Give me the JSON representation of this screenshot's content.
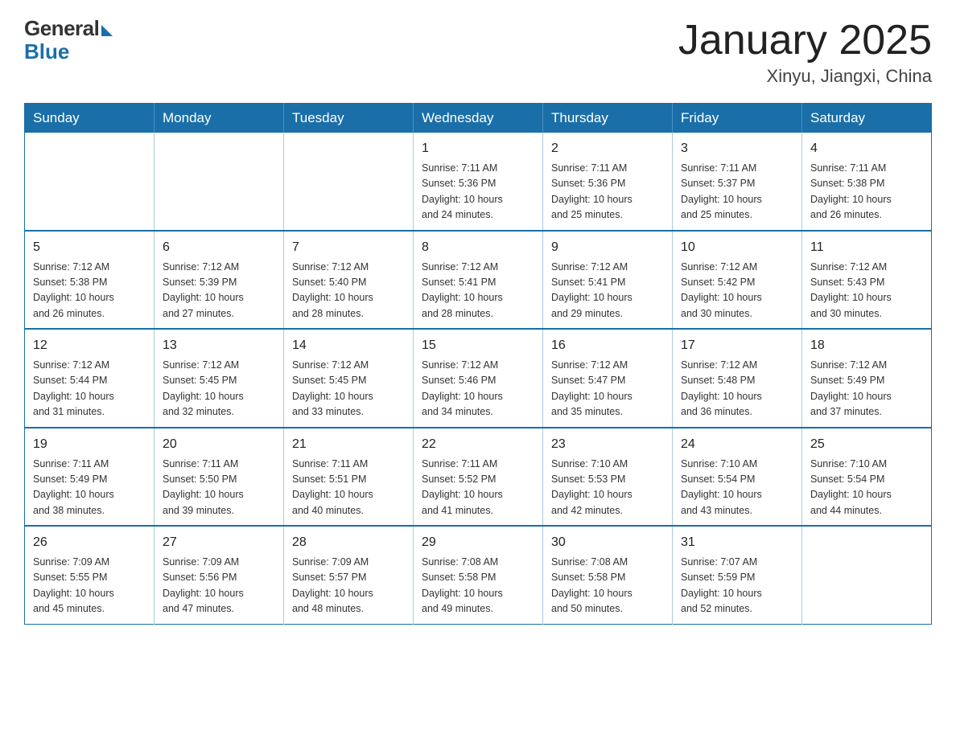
{
  "header": {
    "logo_general": "General",
    "logo_blue": "Blue",
    "title": "January 2025",
    "location": "Xinyu, Jiangxi, China"
  },
  "days_of_week": [
    "Sunday",
    "Monday",
    "Tuesday",
    "Wednesday",
    "Thursday",
    "Friday",
    "Saturday"
  ],
  "weeks": [
    [
      {
        "day": "",
        "info": ""
      },
      {
        "day": "",
        "info": ""
      },
      {
        "day": "",
        "info": ""
      },
      {
        "day": "1",
        "info": "Sunrise: 7:11 AM\nSunset: 5:36 PM\nDaylight: 10 hours\nand 24 minutes."
      },
      {
        "day": "2",
        "info": "Sunrise: 7:11 AM\nSunset: 5:36 PM\nDaylight: 10 hours\nand 25 minutes."
      },
      {
        "day": "3",
        "info": "Sunrise: 7:11 AM\nSunset: 5:37 PM\nDaylight: 10 hours\nand 25 minutes."
      },
      {
        "day": "4",
        "info": "Sunrise: 7:11 AM\nSunset: 5:38 PM\nDaylight: 10 hours\nand 26 minutes."
      }
    ],
    [
      {
        "day": "5",
        "info": "Sunrise: 7:12 AM\nSunset: 5:38 PM\nDaylight: 10 hours\nand 26 minutes."
      },
      {
        "day": "6",
        "info": "Sunrise: 7:12 AM\nSunset: 5:39 PM\nDaylight: 10 hours\nand 27 minutes."
      },
      {
        "day": "7",
        "info": "Sunrise: 7:12 AM\nSunset: 5:40 PM\nDaylight: 10 hours\nand 28 minutes."
      },
      {
        "day": "8",
        "info": "Sunrise: 7:12 AM\nSunset: 5:41 PM\nDaylight: 10 hours\nand 28 minutes."
      },
      {
        "day": "9",
        "info": "Sunrise: 7:12 AM\nSunset: 5:41 PM\nDaylight: 10 hours\nand 29 minutes."
      },
      {
        "day": "10",
        "info": "Sunrise: 7:12 AM\nSunset: 5:42 PM\nDaylight: 10 hours\nand 30 minutes."
      },
      {
        "day": "11",
        "info": "Sunrise: 7:12 AM\nSunset: 5:43 PM\nDaylight: 10 hours\nand 30 minutes."
      }
    ],
    [
      {
        "day": "12",
        "info": "Sunrise: 7:12 AM\nSunset: 5:44 PM\nDaylight: 10 hours\nand 31 minutes."
      },
      {
        "day": "13",
        "info": "Sunrise: 7:12 AM\nSunset: 5:45 PM\nDaylight: 10 hours\nand 32 minutes."
      },
      {
        "day": "14",
        "info": "Sunrise: 7:12 AM\nSunset: 5:45 PM\nDaylight: 10 hours\nand 33 minutes."
      },
      {
        "day": "15",
        "info": "Sunrise: 7:12 AM\nSunset: 5:46 PM\nDaylight: 10 hours\nand 34 minutes."
      },
      {
        "day": "16",
        "info": "Sunrise: 7:12 AM\nSunset: 5:47 PM\nDaylight: 10 hours\nand 35 minutes."
      },
      {
        "day": "17",
        "info": "Sunrise: 7:12 AM\nSunset: 5:48 PM\nDaylight: 10 hours\nand 36 minutes."
      },
      {
        "day": "18",
        "info": "Sunrise: 7:12 AM\nSunset: 5:49 PM\nDaylight: 10 hours\nand 37 minutes."
      }
    ],
    [
      {
        "day": "19",
        "info": "Sunrise: 7:11 AM\nSunset: 5:49 PM\nDaylight: 10 hours\nand 38 minutes."
      },
      {
        "day": "20",
        "info": "Sunrise: 7:11 AM\nSunset: 5:50 PM\nDaylight: 10 hours\nand 39 minutes."
      },
      {
        "day": "21",
        "info": "Sunrise: 7:11 AM\nSunset: 5:51 PM\nDaylight: 10 hours\nand 40 minutes."
      },
      {
        "day": "22",
        "info": "Sunrise: 7:11 AM\nSunset: 5:52 PM\nDaylight: 10 hours\nand 41 minutes."
      },
      {
        "day": "23",
        "info": "Sunrise: 7:10 AM\nSunset: 5:53 PM\nDaylight: 10 hours\nand 42 minutes."
      },
      {
        "day": "24",
        "info": "Sunrise: 7:10 AM\nSunset: 5:54 PM\nDaylight: 10 hours\nand 43 minutes."
      },
      {
        "day": "25",
        "info": "Sunrise: 7:10 AM\nSunset: 5:54 PM\nDaylight: 10 hours\nand 44 minutes."
      }
    ],
    [
      {
        "day": "26",
        "info": "Sunrise: 7:09 AM\nSunset: 5:55 PM\nDaylight: 10 hours\nand 45 minutes."
      },
      {
        "day": "27",
        "info": "Sunrise: 7:09 AM\nSunset: 5:56 PM\nDaylight: 10 hours\nand 47 minutes."
      },
      {
        "day": "28",
        "info": "Sunrise: 7:09 AM\nSunset: 5:57 PM\nDaylight: 10 hours\nand 48 minutes."
      },
      {
        "day": "29",
        "info": "Sunrise: 7:08 AM\nSunset: 5:58 PM\nDaylight: 10 hours\nand 49 minutes."
      },
      {
        "day": "30",
        "info": "Sunrise: 7:08 AM\nSunset: 5:58 PM\nDaylight: 10 hours\nand 50 minutes."
      },
      {
        "day": "31",
        "info": "Sunrise: 7:07 AM\nSunset: 5:59 PM\nDaylight: 10 hours\nand 52 minutes."
      },
      {
        "day": "",
        "info": ""
      }
    ]
  ]
}
